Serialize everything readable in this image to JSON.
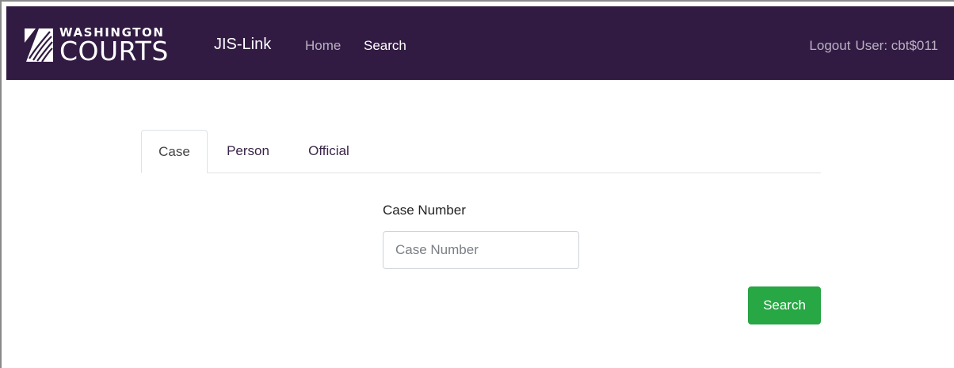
{
  "navbar": {
    "logo": {
      "line1": "WASHINGTON",
      "line2": "COURTS",
      "icon": "washington-courts-logo-icon"
    },
    "app_name": "JIS-Link",
    "links": {
      "home": "Home",
      "search": "Search"
    },
    "logout": "Logout",
    "user": "User: cbt$011"
  },
  "tabs": {
    "case": "Case",
    "person": "Person",
    "official": "Official",
    "active": "Case"
  },
  "form": {
    "case_number_label": "Case Number",
    "case_number_placeholder": "Case Number",
    "case_number_value": "",
    "search_button": "Search"
  },
  "colors": {
    "navbar_bg": "#321b43",
    "search_button": "#28a745"
  }
}
